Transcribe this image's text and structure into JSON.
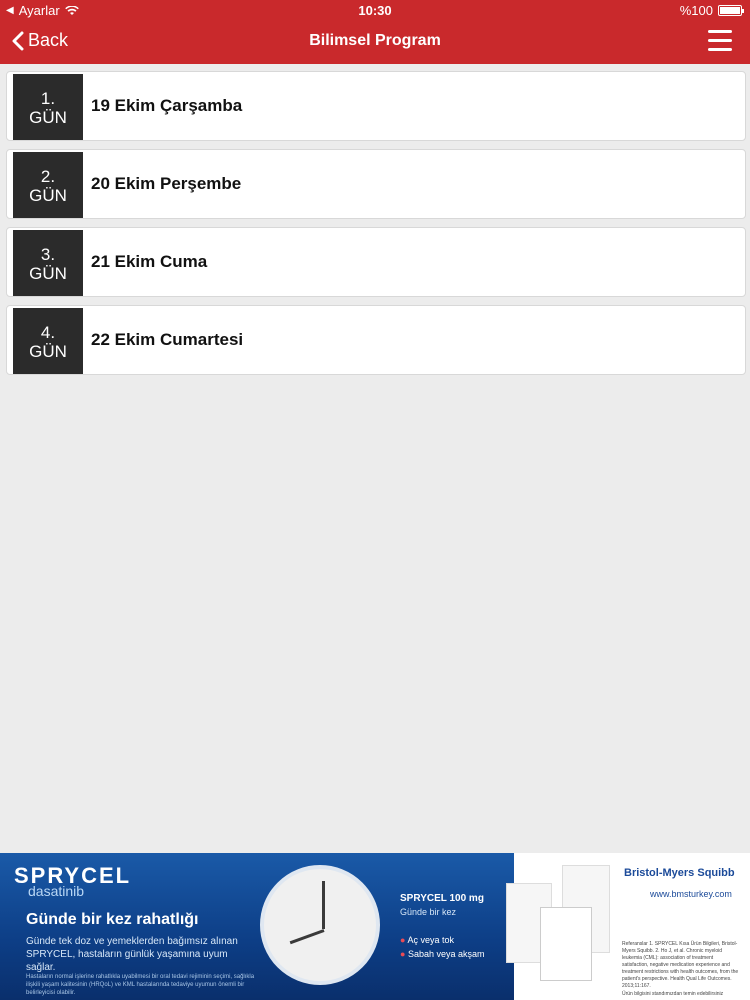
{
  "status_bar": {
    "carrier": "Ayarlar",
    "time": "10:30",
    "battery": "%100"
  },
  "nav": {
    "back_label": "Back",
    "title": "Bilimsel Program"
  },
  "days": [
    {
      "num": "1.",
      "gun": "GÜN",
      "label": "19 Ekim Çarşamba"
    },
    {
      "num": "2.",
      "gun": "GÜN",
      "label": "20 Ekim Perşembe"
    },
    {
      "num": "3.",
      "gun": "GÜN",
      "label": "21 Ekim Cuma"
    },
    {
      "num": "4.",
      "gun": "GÜN",
      "label": "22 Ekim Cumartesi"
    }
  ],
  "ad": {
    "brand": "SPRYCEL",
    "brand_sub": "dasatinib",
    "headline": "Günde bir kez rahatlığı",
    "subline": "Günde tek doz ve yemeklerden bağımsız alınan SPRYCEL, hastaların günlük yaşamına uyum sağlar.",
    "foot": "Hastaların normal işlerine rahatlıkla uyabilmesi bir oral tedavi rejiminin seçimi, sağlıkla ilişkili yaşam kalitesinin (HRQoL) ve KML hastalarında tedaviye uyumun önemli bir belirleyicisi olabilir.",
    "product": "SPRYCEL 100 mg",
    "product_sub": "Günde bir kez",
    "bullet1": "Aç veya tok",
    "bullet2": "Sabah veya akşam",
    "company": "Bristol-Myers Squibb",
    "url": "www.bmsturkey.com",
    "refs": "Referanslar 1. SPRYCEL Kısa Ürün Bilgileri, Bristol-Myers Squibb. 2. Ho J, et al. Chronic myeloid leukemia (CML): association of treatment satisfaction, negative medication experience and treatment restrictions with health outcomes, from the patient's perspective. Health Qual Life Outcomes. 2013;11:167.",
    "refs_bottom": "Ürün bilgisini standımızdan temin edebilirsiniz"
  }
}
